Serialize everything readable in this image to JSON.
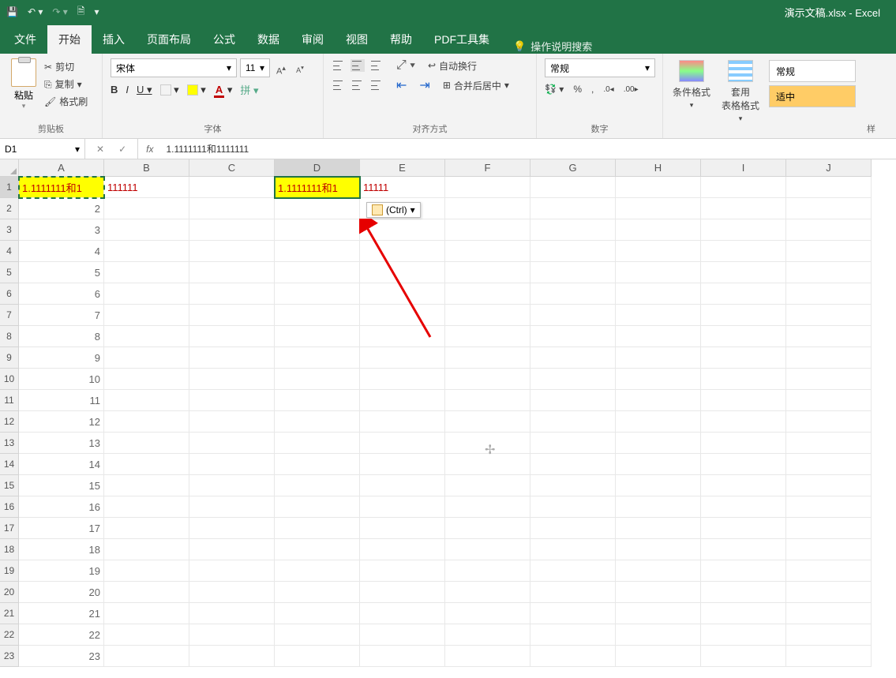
{
  "app": {
    "title": "演示文稿.xlsx  -  Excel"
  },
  "tabs": {
    "file": "文件",
    "home": "开始",
    "insert": "插入",
    "layout": "页面布局",
    "formula": "公式",
    "data": "数据",
    "review": "审阅",
    "view": "视图",
    "help": "帮助",
    "pdf": "PDF工具集",
    "search": "操作说明搜索"
  },
  "ribbon": {
    "clipboard": {
      "paste": "粘贴",
      "cut": "剪切",
      "copy": "复制",
      "format_painter": "格式刷",
      "label": "剪贴板"
    },
    "font": {
      "name": "宋体",
      "size": "11",
      "label": "字体"
    },
    "align": {
      "wrap": "自动换行",
      "merge": "合并后居中",
      "label": "对齐方式"
    },
    "number": {
      "format": "常规",
      "label": "数字"
    },
    "styles": {
      "cond": "条件格式",
      "table": "套用\n表格格式",
      "normal": "常规",
      "good": "适中",
      "label_right": "样"
    }
  },
  "fbar": {
    "name_box": "D1",
    "formula": "1.1111111和1111111"
  },
  "columns": [
    "A",
    "B",
    "C",
    "D",
    "E",
    "F",
    "G",
    "H",
    "I",
    "J"
  ],
  "rows": [
    1,
    2,
    3,
    4,
    5,
    6,
    7,
    8,
    9,
    10,
    11,
    12,
    13,
    14,
    15,
    16,
    17,
    18,
    19,
    20,
    21,
    22,
    23
  ],
  "cells": {
    "A1": "1.1111111和1",
    "A1_overflow": "111111",
    "D1": "1.1111111和1",
    "D1_overflow": "11111",
    "A2": "2",
    "A3": "3",
    "A4": "4",
    "A5": "5",
    "A6": "6",
    "A7": "7",
    "A8": "8",
    "A9": "9",
    "A10": "10",
    "A11": "11",
    "A12": "12",
    "A13": "13",
    "A14": "14",
    "A15": "15",
    "A16": "16",
    "A17": "17",
    "A18": "18",
    "A19": "19",
    "A20": "20",
    "A21": "21",
    "A22": "22",
    "A23": "23"
  },
  "paste_tag": "(Ctrl)"
}
